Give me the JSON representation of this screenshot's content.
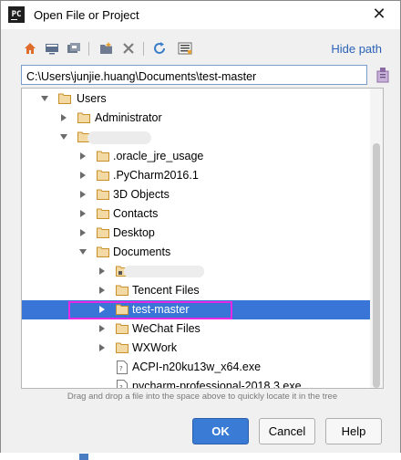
{
  "window": {
    "title": "Open File or Project",
    "app_icon_text": "PC",
    "close_glyph": "✕"
  },
  "toolbar": {
    "hide_path_label": "Hide path",
    "icons": [
      "home-icon",
      "desktop-icon",
      "project-icon",
      "new-folder-icon",
      "delete-icon",
      "refresh-icon",
      "show-hidden-icon"
    ]
  },
  "path": {
    "value": "C:\\Users\\junjie.huang\\Documents\\test-master"
  },
  "tree": {
    "items": [
      {
        "label": "Users",
        "expanded": true
      },
      {
        "label": "Administrator",
        "expanded": false
      },
      {
        "label": "",
        "expanded": true
      },
      {
        "label": ".oracle_jre_usage"
      },
      {
        "label": ".PyCharm2016.1"
      },
      {
        "label": "3D Objects"
      },
      {
        "label": "Contacts"
      },
      {
        "label": "Desktop"
      },
      {
        "label": "Documents",
        "expanded": true
      },
      {
        "label": "",
        "note": "partially hidden"
      },
      {
        "label": "Tencent Files"
      },
      {
        "label": "test-master",
        "selected": true
      },
      {
        "label": "WeChat Files"
      },
      {
        "label": "WXWork"
      },
      {
        "label": "ACPI-n20ku13w_x64.exe"
      },
      {
        "label": "pycharm-professional-2018.3.exe"
      }
    ]
  },
  "hint": "Drag and drop a file into the space above to quickly locate it in the tree",
  "buttons": {
    "ok": "OK",
    "cancel": "Cancel",
    "help": "Help"
  },
  "colors": {
    "selection": "#3875d7",
    "link": "#2a62b8",
    "highlight": "#e629e6",
    "folder": "#d9a441"
  }
}
